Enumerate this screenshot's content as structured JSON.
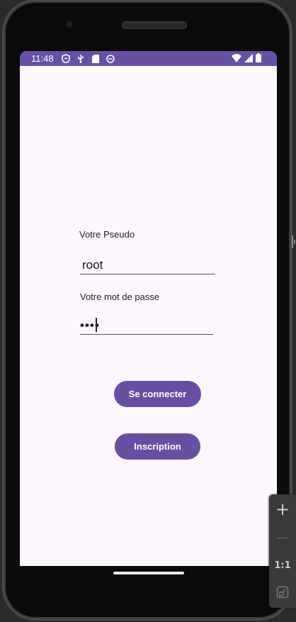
{
  "status_bar": {
    "time": "11:48",
    "left_icons": [
      "shield-icon",
      "usb-icon",
      "sd-card-icon",
      "sync-icon"
    ],
    "right_icons": [
      "wifi-icon",
      "signal-icon",
      "battery-icon"
    ],
    "color": "#6750a4"
  },
  "login_form": {
    "pseudo_label": "Votre Pseudo",
    "pseudo_value": "root",
    "password_label": "Votre mot de passe",
    "password_value": "••••"
  },
  "buttons": {
    "login": "Se connecter",
    "signup": "Inscription"
  },
  "colors": {
    "accent": "#6750a4",
    "background": "#fef7fe"
  },
  "emulator_panel": {
    "zoom_in": "+",
    "zoom_out": "—",
    "actual_size": "1:1"
  }
}
